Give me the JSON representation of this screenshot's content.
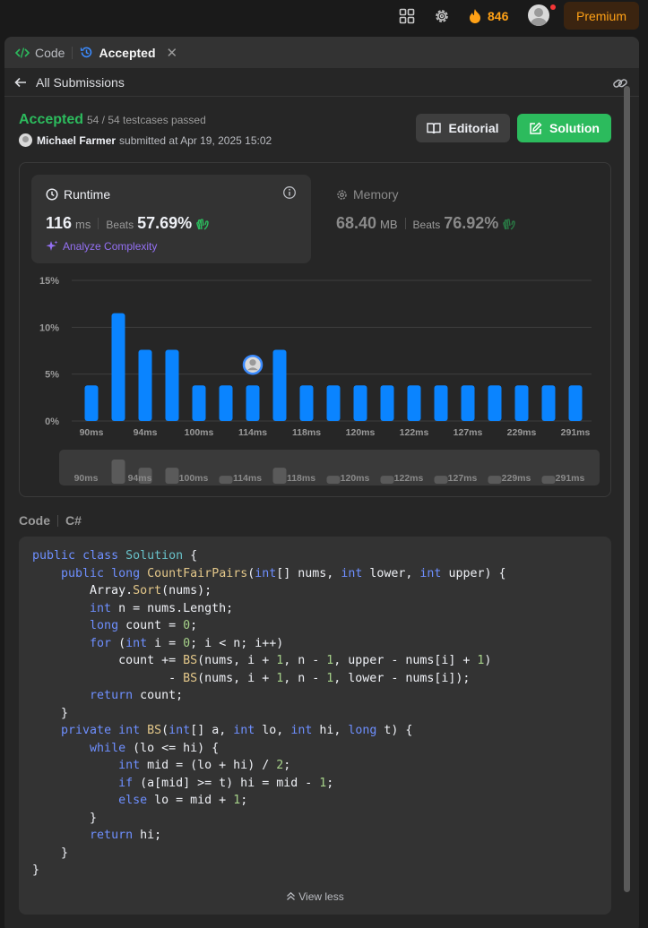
{
  "topnav": {
    "streak_count": "846",
    "premium_label": "Premium"
  },
  "tabs": [
    {
      "label": "Code"
    },
    {
      "label": "Accepted"
    }
  ],
  "subbar": {
    "back_label": "All Submissions"
  },
  "submission": {
    "status": "Accepted",
    "testcases": "54 / 54 testcases passed",
    "username": "Michael Farmer",
    "submitted_text": "submitted at Apr 19, 2025 15:02",
    "editorial_label": "Editorial",
    "solution_label": "Solution"
  },
  "runtime": {
    "label": "Runtime",
    "value": "116",
    "unit": "ms",
    "beats_label": "Beats",
    "beats_value": "57.69%",
    "analyze_label": "Analyze Complexity"
  },
  "memory": {
    "label": "Memory",
    "value": "68.40",
    "unit": "MB",
    "beats_label": "Beats",
    "beats_value": "76.92%"
  },
  "chart_data": {
    "type": "bar",
    "values": [
      3.8,
      11.5,
      7.6,
      7.6,
      3.8,
      3.8,
      3.8,
      7.6,
      3.8,
      3.8,
      3.8,
      3.8,
      3.8,
      3.8,
      3.8,
      3.8,
      3.8,
      3.8,
      3.8
    ],
    "ylim": [
      0,
      15
    ],
    "y_ticks": [
      "0%",
      "5%",
      "10%",
      "15%"
    ],
    "x_tick_labels": [
      "90ms",
      "94ms",
      "100ms",
      "114ms",
      "118ms",
      "120ms",
      "122ms",
      "127ms",
      "229ms",
      "291ms"
    ],
    "user_bar_index": 6,
    "grid": true,
    "bar_color": "#0a84ff",
    "overview_values": [
      0.0,
      11.5,
      7.6,
      7.6,
      0.0,
      3.8,
      0.0,
      7.6,
      0.0,
      3.8,
      0.0,
      3.8,
      0.0,
      3.8,
      0.0,
      3.8,
      0.0,
      3.8,
      0.0
    ]
  },
  "code": {
    "label": "Code",
    "language": "C#",
    "view_less_label": "View less"
  }
}
